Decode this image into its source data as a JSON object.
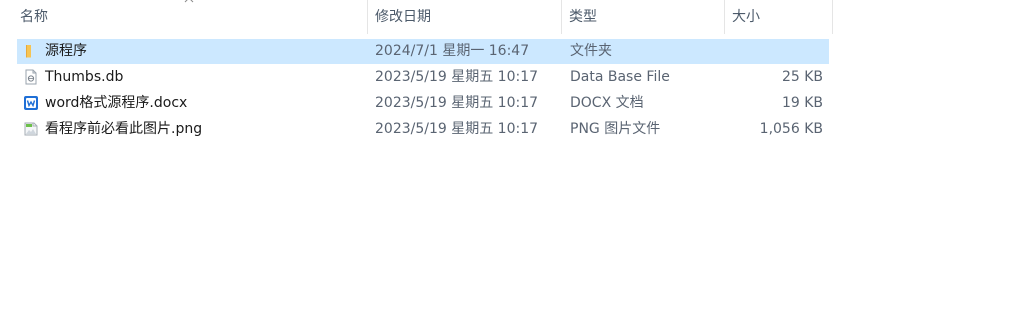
{
  "header": {
    "name": "名称",
    "date": "修改日期",
    "type": "类型",
    "size": "大小"
  },
  "files": [
    {
      "icon": "folder-icon",
      "name": "源程序",
      "date": "2024/7/1 星期一 16:47",
      "type": "文件夹",
      "size": ""
    },
    {
      "icon": "db-file-icon",
      "name": "Thumbs.db",
      "date": "2023/5/19 星期五 10:17",
      "type": "Data Base File",
      "size": "25 KB"
    },
    {
      "icon": "word-doc-icon",
      "name": "word格式源程序.docx",
      "date": "2023/5/19 星期五 10:17",
      "type": "DOCX 文档",
      "size": "19 KB"
    },
    {
      "icon": "image-file-icon",
      "name": "看程序前必看此图片.png",
      "date": "2023/5/19 星期五 10:17",
      "type": "PNG 图片文件",
      "size": "1,056 KB"
    }
  ],
  "colors": {
    "selection": "#cce8ff",
    "folder": "#f2c14e",
    "word": "#1f6fd6"
  }
}
